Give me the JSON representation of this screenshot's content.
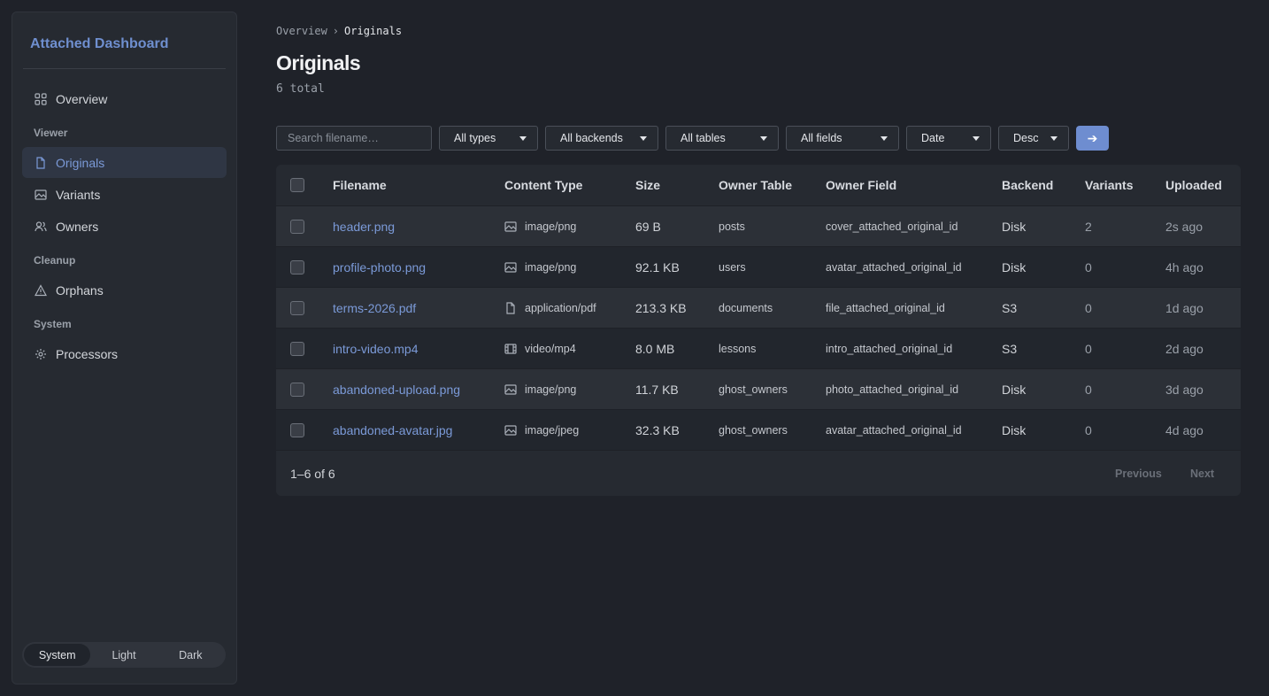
{
  "sidebar": {
    "brand": "Attached Dashboard",
    "items": {
      "overview": "Overview",
      "originals": "Originals",
      "variants": "Variants",
      "owners": "Owners",
      "orphans": "Orphans",
      "processors": "Processors"
    },
    "sections": {
      "viewer": "Viewer",
      "cleanup": "Cleanup",
      "system": "System"
    },
    "active_item": "Originals",
    "theme": {
      "options": [
        "System",
        "Light",
        "Dark"
      ],
      "selected": "System"
    }
  },
  "breadcrumb": {
    "parent": "Overview",
    "separator": "›",
    "current": "Originals"
  },
  "page": {
    "title": "Originals",
    "count": "6 total"
  },
  "filters": {
    "search_placeholder": "Search filename…",
    "types": "All types",
    "backends": "All backends",
    "tables": "All tables",
    "fields": "All fields",
    "sort": "Date",
    "order": "Desc",
    "go": "➔"
  },
  "table": {
    "headers": {
      "filename": "Filename",
      "content_type": "Content Type",
      "size": "Size",
      "owner_table": "Owner Table",
      "owner_field": "Owner Field",
      "backend": "Backend",
      "variants": "Variants",
      "uploaded": "Uploaded"
    },
    "rows": [
      {
        "filename": "header.png",
        "content_type": "image/png",
        "icon": "image-icon",
        "size": "69 B",
        "owner_table": "posts",
        "owner_field": "cover_attached_original_id",
        "backend": "Disk",
        "variants": "2",
        "uploaded": "2s ago"
      },
      {
        "filename": "profile-photo.png",
        "content_type": "image/png",
        "icon": "image-icon",
        "size": "92.1 KB",
        "owner_table": "users",
        "owner_field": "avatar_attached_original_id",
        "backend": "Disk",
        "variants": "0",
        "uploaded": "4h ago"
      },
      {
        "filename": "terms-2026.pdf",
        "content_type": "application/pdf",
        "icon": "file-icon",
        "size": "213.3 KB",
        "owner_table": "documents",
        "owner_field": "file_attached_original_id",
        "backend": "S3",
        "variants": "0",
        "uploaded": "1d ago"
      },
      {
        "filename": "intro-video.mp4",
        "content_type": "video/mp4",
        "icon": "film-icon",
        "size": "8.0 MB",
        "owner_table": "lessons",
        "owner_field": "intro_attached_original_id",
        "backend": "S3",
        "variants": "0",
        "uploaded": "2d ago"
      },
      {
        "filename": "abandoned-upload.png",
        "content_type": "image/png",
        "icon": "image-icon",
        "size": "11.7 KB",
        "owner_table": "ghost_owners",
        "owner_field": "photo_attached_original_id",
        "backend": "Disk",
        "variants": "0",
        "uploaded": "3d ago"
      },
      {
        "filename": "abandoned-avatar.jpg",
        "content_type": "image/jpeg",
        "icon": "image-icon",
        "size": "32.3 KB",
        "owner_table": "ghost_owners",
        "owner_field": "avatar_attached_original_id",
        "backend": "Disk",
        "variants": "0",
        "uploaded": "4d ago"
      }
    ]
  },
  "pagination": {
    "range": "1–6 of 6",
    "previous": "Previous",
    "next": "Next"
  },
  "colors": {
    "accent": "#6e8dd0",
    "link": "#7b9ad8",
    "background": "#1f2229",
    "panel": "#262a31"
  }
}
